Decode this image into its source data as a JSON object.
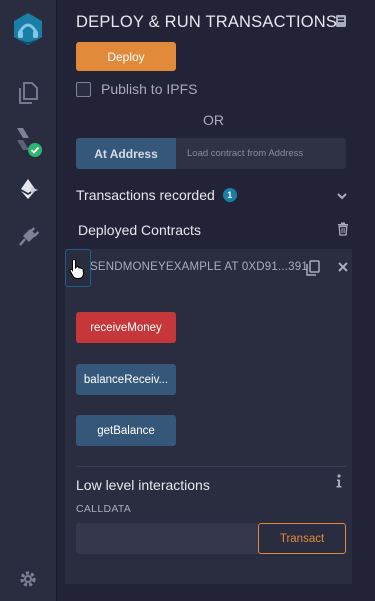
{
  "sidebar": {
    "icons": [
      "remix-logo-icon",
      "file-explorer-icon",
      "solidity-compiler-icon",
      "deploy-run-icon",
      "plugin-manager-icon",
      "settings-icon"
    ]
  },
  "header": {
    "title": "DEPLOY & RUN TRANSACTIONS"
  },
  "deploy": {
    "deploy_label": "Deploy",
    "publish_ipfs_label": "Publish to IPFS",
    "or_label": "OR",
    "at_address_label": "At Address",
    "address_placeholder": "Load contract from Address"
  },
  "transactions": {
    "label": "Transactions recorded",
    "count": "1"
  },
  "deployed": {
    "title": "Deployed Contracts",
    "contract": {
      "name": "SENDMONEYEXAMPLE AT 0XD91...391",
      "functions": [
        {
          "label": "receiveMoney",
          "kind": "payable"
        },
        {
          "label": "balanceReceiv...",
          "kind": "view"
        },
        {
          "label": "getBalance",
          "kind": "view"
        }
      ],
      "low_level": {
        "title": "Low level interactions",
        "calldata_label": "CALLDATA",
        "calldata_value": "",
        "transact_label": "Transact"
      }
    }
  },
  "colors": {
    "accent_orange": "#e08a3a",
    "payable_red": "#c5373b",
    "view_blue": "#35577a",
    "badge_blue": "#1b7ea6",
    "check_green": "#2bb673"
  }
}
